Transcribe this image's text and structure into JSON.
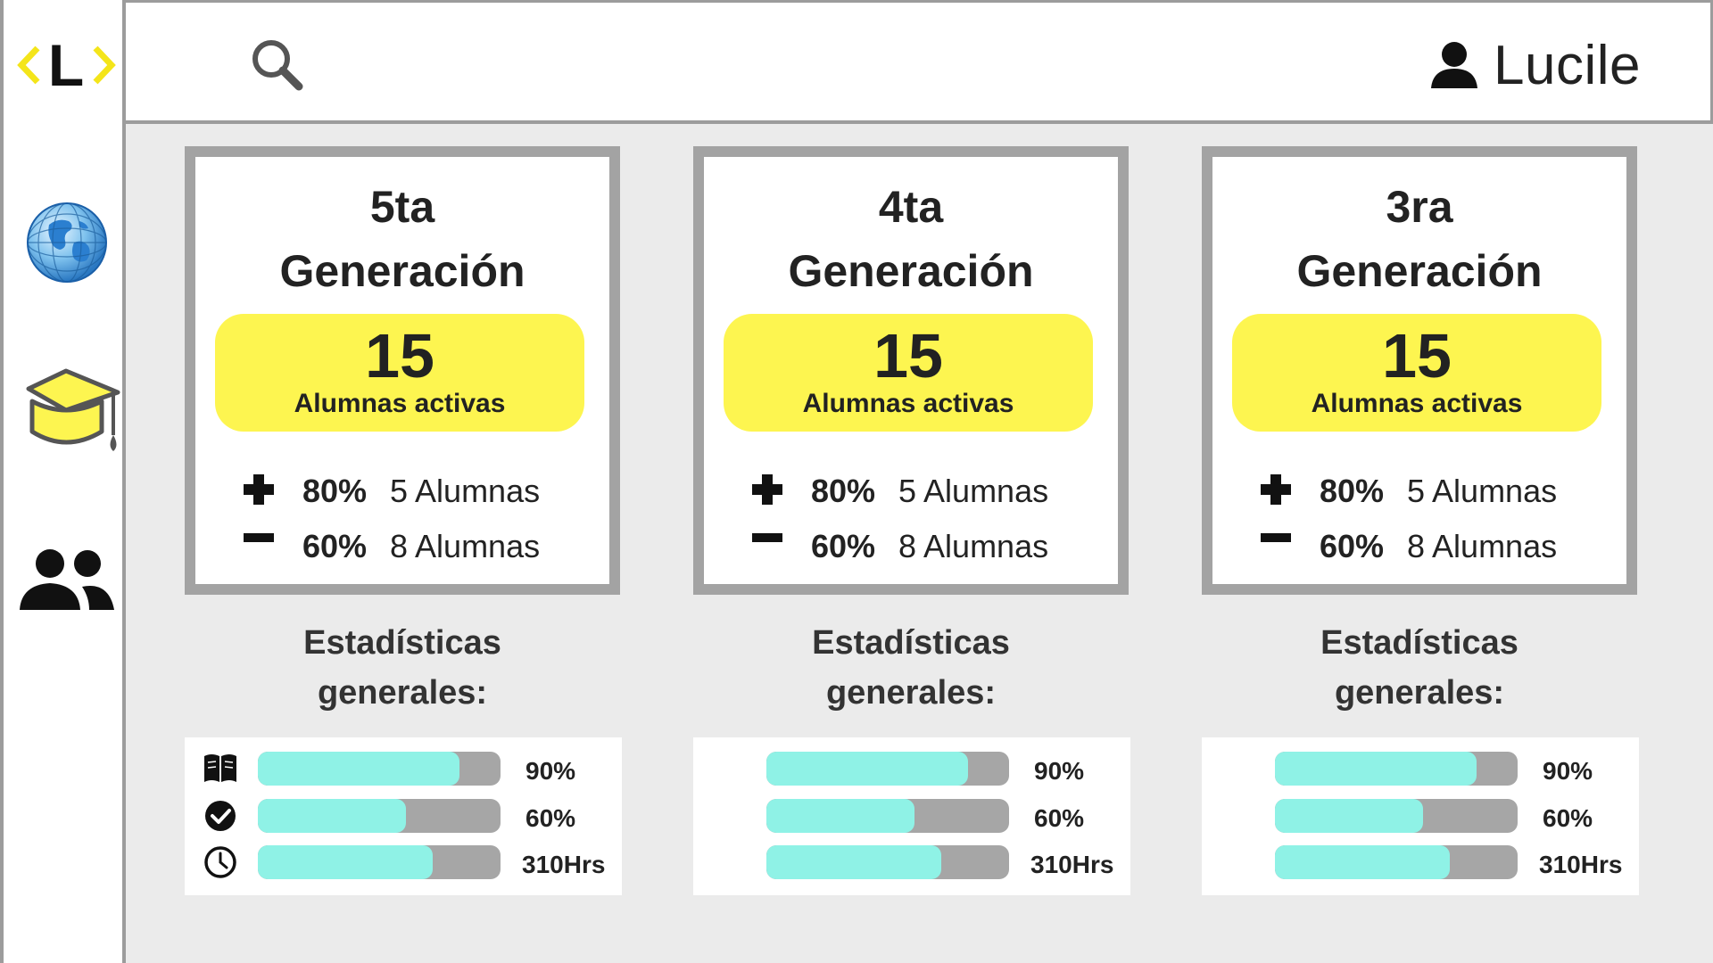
{
  "app": {
    "logo_letter": "L",
    "accent_color": "#fdf550",
    "bar_fill_color": "#8ff2e6",
    "bar_track_color": "#a6a6a6"
  },
  "sidebar": {
    "items": [
      {
        "icon": "globe-icon"
      },
      {
        "icon": "graduation-cap-icon"
      },
      {
        "icon": "people-icon"
      }
    ]
  },
  "header": {
    "search_icon": "search-icon",
    "user_icon": "user-icon",
    "user_name": "Lucile"
  },
  "generations": [
    {
      "title_line1": "5ta",
      "title_line2": "Generación",
      "active_count": "15",
      "active_label": "Alumnas activas",
      "plus": {
        "pct": "80%",
        "count": "5 Alumnas"
      },
      "minus": {
        "pct": "60%",
        "count": "8 Alumnas"
      },
      "stats_title_line1": "Estadísticas",
      "stats_title_line2": "generales:",
      "bars": [
        {
          "icon": "book-icon",
          "value_label": "90%",
          "fill": 0.83
        },
        {
          "icon": "check-circle-icon",
          "value_label": "60%",
          "fill": 0.61
        },
        {
          "icon": "clock-icon",
          "value_label": "310Hrs",
          "fill": 0.72
        }
      ]
    },
    {
      "title_line1": "4ta",
      "title_line2": "Generación",
      "active_count": "15",
      "active_label": "Alumnas activas",
      "plus": {
        "pct": "80%",
        "count": "5 Alumnas"
      },
      "minus": {
        "pct": "60%",
        "count": "8 Alumnas"
      },
      "stats_title_line1": "Estadísticas",
      "stats_title_line2": "generales:",
      "bars": [
        {
          "value_label": "90%",
          "fill": 0.83
        },
        {
          "value_label": "60%",
          "fill": 0.61
        },
        {
          "value_label": "310Hrs",
          "fill": 0.72
        }
      ]
    },
    {
      "title_line1": "3ra",
      "title_line2": "Generación",
      "active_count": "15",
      "active_label": "Alumnas activas",
      "plus": {
        "pct": "80%",
        "count": "5 Alumnas"
      },
      "minus": {
        "pct": "60%",
        "count": "8 Alumnas"
      },
      "stats_title_line1": "Estadísticas",
      "stats_title_line2": "generales:",
      "bars": [
        {
          "value_label": "90%",
          "fill": 0.83
        },
        {
          "value_label": "60%",
          "fill": 0.61
        },
        {
          "value_label": "310Hrs",
          "fill": 0.72
        }
      ]
    }
  ]
}
